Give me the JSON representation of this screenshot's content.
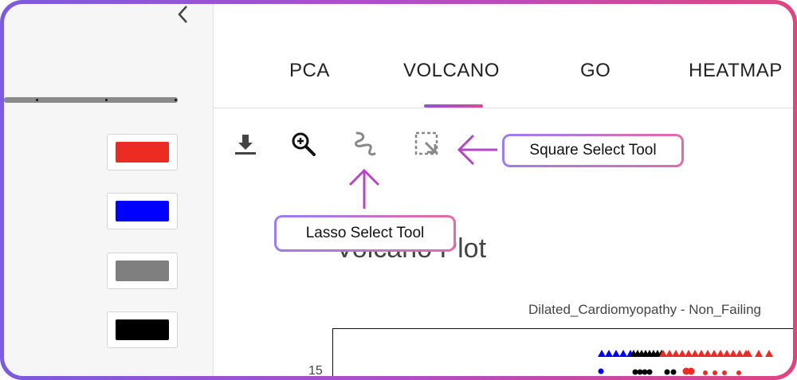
{
  "sidebar": {
    "collapse_icon": "chevron-left-icon",
    "colors": [
      {
        "name": "red",
        "hex": "#ec2b23"
      },
      {
        "name": "blue",
        "hex": "#0000ff"
      },
      {
        "name": "gray",
        "hex": "#7f7f7f"
      },
      {
        "name": "black",
        "hex": "#000000"
      }
    ]
  },
  "tabs": [
    {
      "label": "PCA"
    },
    {
      "label": "VOLCANO",
      "active": true
    },
    {
      "label": "GO"
    },
    {
      "label": "HEATMAP"
    }
  ],
  "toolbar": {
    "icons": [
      "download-icon",
      "zoom-in-icon",
      "lasso-select-icon",
      "square-select-icon"
    ]
  },
  "callouts": {
    "square": "Square Select Tool",
    "lasso": "Lasso Select Tool"
  },
  "accent_gradient": [
    "#7b5be0",
    "#e0457f"
  ],
  "plot": {
    "title": "Volcano Plot",
    "subtitle": "Dilated_Cardiomyopathy - Non_Failing",
    "ytick_visible": "15"
  }
}
